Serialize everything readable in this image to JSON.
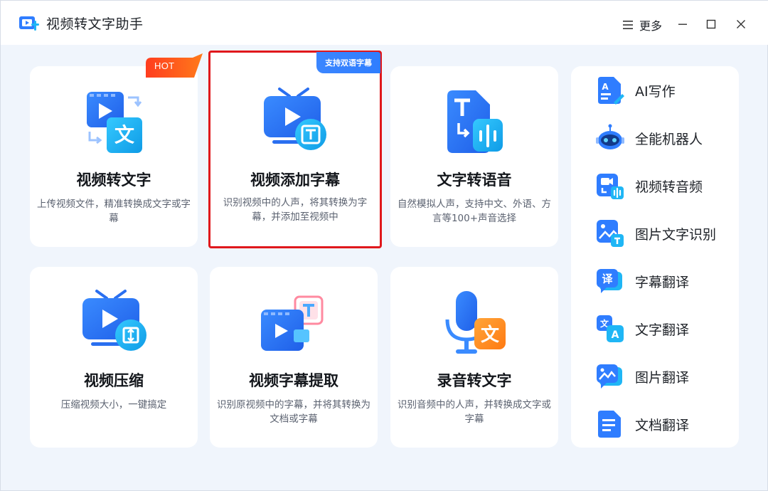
{
  "app": {
    "title": "视频转文字助手",
    "more_label": "更多"
  },
  "cards": [
    {
      "title": "视频转文字",
      "desc": "上传视频文件，精准转换成文字或字幕",
      "badge": "HOT"
    },
    {
      "title": "视频添加字幕",
      "desc": "识别视频中的人声，将其转换为字幕，并添加至视频中",
      "badge": "支持双语字幕"
    },
    {
      "title": "文字转语音",
      "desc": "自然模拟人声，支持中文、外语、方言等100+声音选择"
    },
    {
      "title": "视频压缩",
      "desc": "压缩视频大小，一键搞定"
    },
    {
      "title": "视频字幕提取",
      "desc": "识别原视频中的字幕，并将其转换为文档或字幕"
    },
    {
      "title": "录音转文字",
      "desc": "识别音频中的人声，并转换成文字或字幕"
    }
  ],
  "sidebar": {
    "items": [
      {
        "label": "AI写作",
        "icon": "ai-writing-icon"
      },
      {
        "label": "全能机器人",
        "icon": "robot-icon"
      },
      {
        "label": "视频转音频",
        "icon": "video-to-audio-icon"
      },
      {
        "label": "图片文字识别",
        "icon": "image-ocr-icon"
      },
      {
        "label": "字幕翻译",
        "icon": "subtitle-translate-icon"
      },
      {
        "label": "文字翻译",
        "icon": "text-translate-icon"
      },
      {
        "label": "图片翻译",
        "icon": "image-translate-icon"
      },
      {
        "label": "文档翻译",
        "icon": "document-translate-icon"
      }
    ]
  },
  "colors": {
    "accent": "#2f7dff",
    "icon_cyan": "#1fb6f5",
    "hot": "#ff4a1c",
    "selected_border": "#e0181c",
    "orange": "#ff8a1f"
  }
}
